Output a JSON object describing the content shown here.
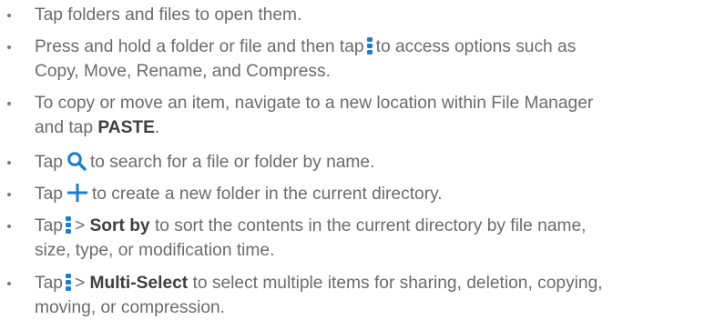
{
  "colors": {
    "text": "#6b6b6b",
    "bold": "#3f3f3f",
    "icon_blue": "#1a7fd4",
    "bullet": "#7a7a7a"
  },
  "icons": {
    "menu": "vertical-dots-icon",
    "search": "search-icon",
    "add": "plus-icon"
  },
  "items": [
    {
      "t1": "Tap folders and files to open them."
    },
    {
      "t1": "Press and hold a folder or file and then tap",
      "t2": "to access options such as",
      "t3": "Copy, Move, Rename, and Compress."
    },
    {
      "t1": "To copy or move an item, navigate to a new location within File Manager",
      "t2": "and tap",
      "bold": "PASTE",
      "t3": "."
    },
    {
      "t1": "Tap",
      "t2": "to search for a file or folder by name."
    },
    {
      "t1": "Tap",
      "t2": "to create a new folder in the current directory."
    },
    {
      "t1": "Tap",
      "t2": ">",
      "bold": "Sort by",
      "t3": "to sort the contents in the current directory by file name,",
      "t4": "size, type, or modification time."
    },
    {
      "t1": "Tap",
      "t2": ">",
      "bold": "Multi-Select",
      "t3": "to select multiple items for sharing, deletion, copying,",
      "t4": "moving, or compression."
    }
  ]
}
